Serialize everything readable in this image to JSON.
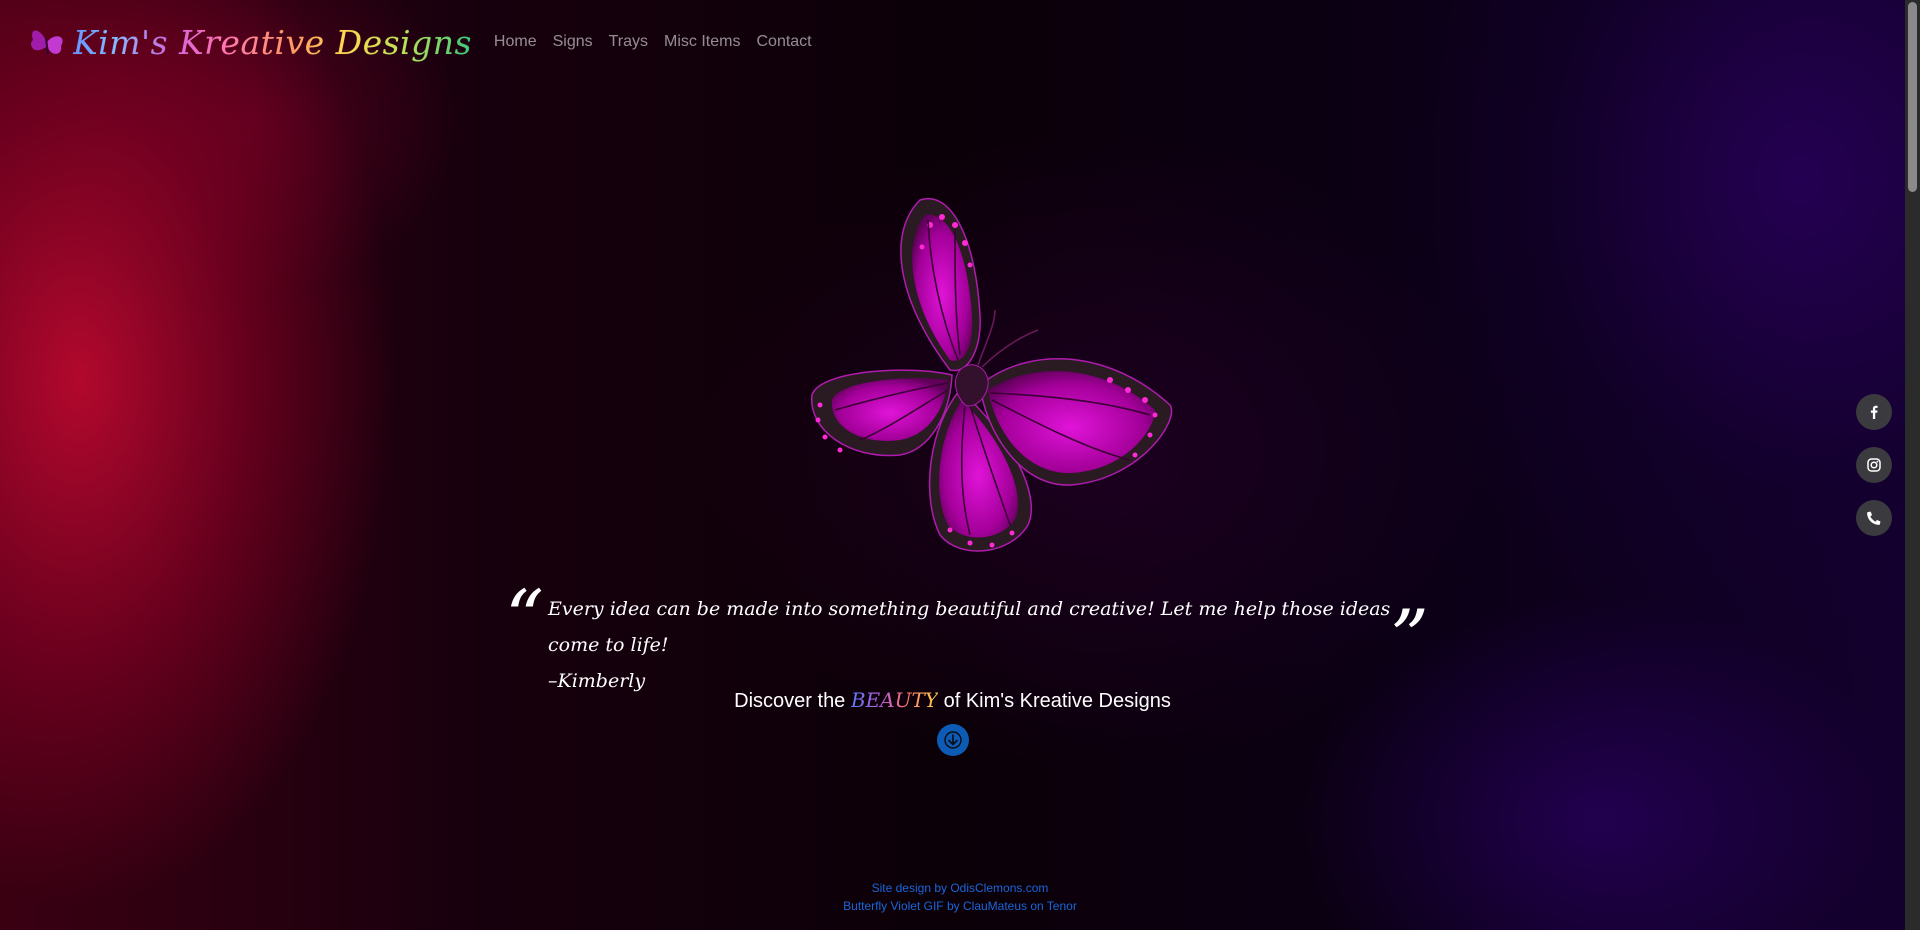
{
  "site": {
    "logo_text": "Kim's Kreative Designs"
  },
  "nav": {
    "items": [
      {
        "label": "Home"
      },
      {
        "label": "Signs"
      },
      {
        "label": "Trays"
      },
      {
        "label": "Misc Items"
      },
      {
        "label": "Contact"
      }
    ]
  },
  "hero": {
    "image_icon": "butterfly-icon",
    "quote_open": "“",
    "quote_close": "”",
    "quote_text": "Every idea can be made into something beautiful and creative! Let me help those ideas come to life!",
    "quote_author": "–Kimberly"
  },
  "discover": {
    "prefix": "Discover the",
    "highlight": "BEAUTY",
    "suffix": "of Kim's Kreative Designs",
    "scroll_icon": "arrow-down-icon"
  },
  "social": {
    "facebook_icon": "facebook-icon",
    "instagram_icon": "instagram-icon",
    "phone_icon": "phone-icon"
  },
  "footer": {
    "credit_line": "Site design by OdisClemons.com",
    "gif_credit": "Butterfly Violet GIF by ClauMateus on Tenor"
  },
  "colors": {
    "accent_magenta": "#c21ac9",
    "scroll_button": "#0d5bb5",
    "footer_link": "#1a66d9",
    "social_button": "#3a3a3f"
  }
}
